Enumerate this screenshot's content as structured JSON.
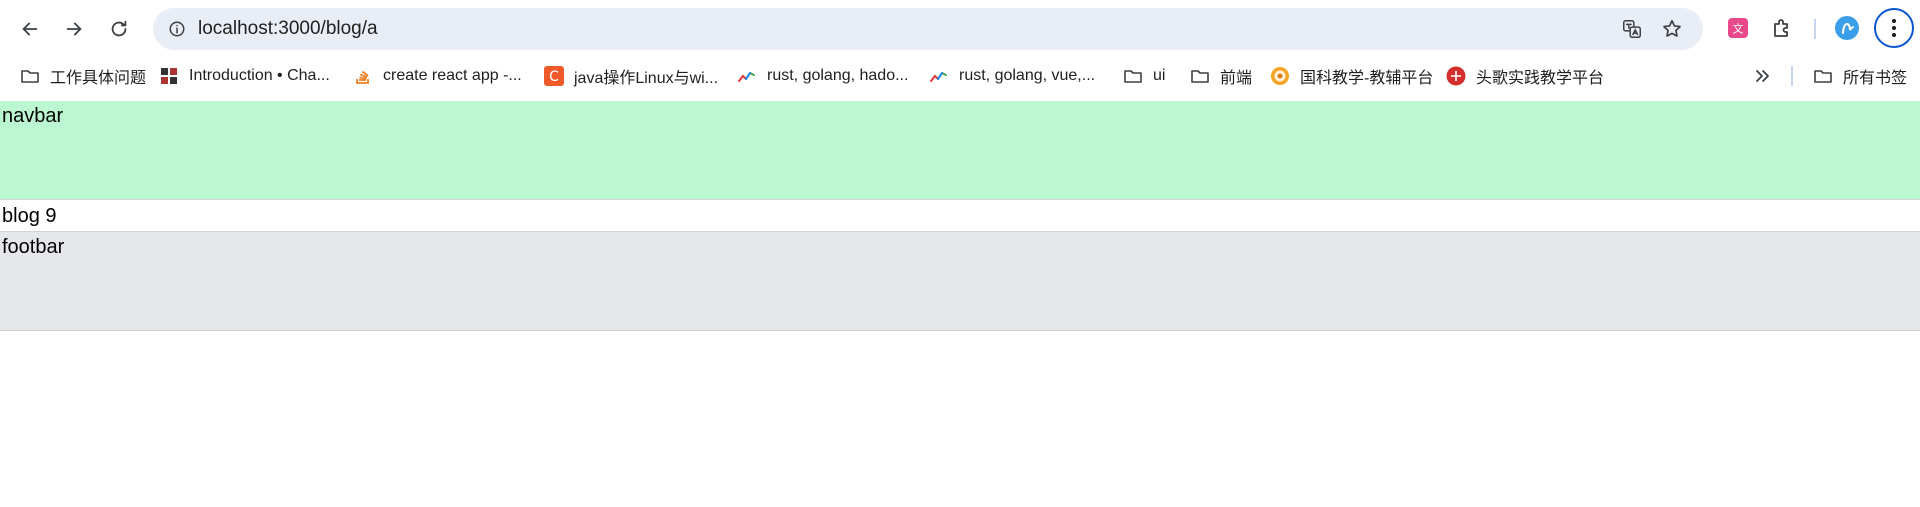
{
  "browser": {
    "url": "localhost:3000/blog/a",
    "accent": "#0b57d0",
    "omnibox_bg": "#e9edf5"
  },
  "bookmarks": {
    "items": [
      {
        "label": "工作具体问题",
        "icon": "folder-icon"
      },
      {
        "label": "Introduction • Cha...",
        "icon": "grid-favicon"
      },
      {
        "label": "create react app -...",
        "icon": "stackoverflow-favicon"
      },
      {
        "label": "java操作Linux与wi...",
        "icon": "c-favicon"
      },
      {
        "label": "rust, golang, hado...",
        "icon": "trend-favicon"
      },
      {
        "label": "rust, golang, vue,...",
        "icon": "trend-favicon"
      },
      {
        "label": "ui",
        "icon": "folder-icon"
      },
      {
        "label": "前端",
        "icon": "folder-icon"
      },
      {
        "label": "国科教学-教辅平台",
        "icon": "school-favicon"
      },
      {
        "label": "头歌实践教学平台",
        "icon": "touge-favicon"
      }
    ],
    "overflow_icon": "double-chevron-icon",
    "all_bookmarks": {
      "label": "所有书签",
      "icon": "folder-icon"
    }
  },
  "page": {
    "navbar_text": "navbar",
    "blog_text": "blog 9",
    "footbar_text": "footbar",
    "navbar_color": "#bbf7d0",
    "footbar_color": "#e5e7eb"
  }
}
